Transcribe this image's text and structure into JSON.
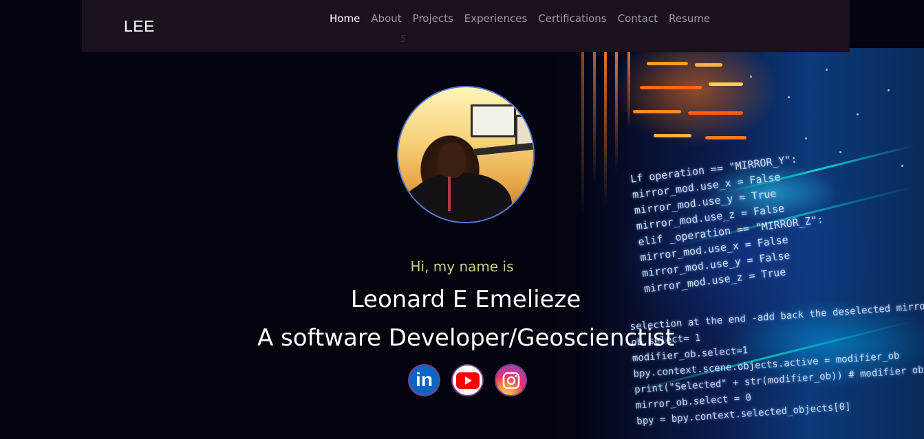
{
  "brand": "LEE",
  "nav": {
    "items": [
      "Home",
      "About",
      "Projects",
      "Experiences",
      "Certifications",
      "Contact",
      "Resume"
    ],
    "active": "Home",
    "badge": "5"
  },
  "hero": {
    "greeting": "Hi, my name is",
    "name": "Leonard E Emelieze",
    "role": "A software Developer/Geoscienctist",
    "avatar_alt": "profile photo"
  },
  "socials": [
    {
      "name": "linkedin",
      "icon": "linkedin-icon",
      "label": "in"
    },
    {
      "name": "youtube",
      "icon": "youtube-icon"
    },
    {
      "name": "instagram",
      "icon": "instagram-icon"
    }
  ],
  "background_code": {
    "lines1": [
      "Lf operation == \"MIRROR_Y\":",
      "mirror_mod.use_x = False",
      "mirror_mod.use_y = True",
      "mirror_mod.use_z = False",
      "elif _operation == \"MIRROR_Z\":",
      "mirror_mod.use_x = False",
      "mirror_mod.use_y = False",
      "mirror_mod.use_z = True"
    ],
    "lines2": [
      "selection at the end -add back the deselected mirro",
      "ob.select= 1",
      "modifier_ob.select=1",
      "bpy.context.scene.objects.active = modifier_ob",
      "print(\"Selected\" + str(modifier_ob)) # modifier ob is th",
      "mirror_ob.select = 0",
      "bpy = bpy.context.selected_objects[0]"
    ]
  },
  "colors": {
    "navbar": "#1a111c",
    "background": "#02030d",
    "greeting": "#c6cf88",
    "nav_inactive": "#9c9aa0",
    "avatar_border": "#5a78d6"
  }
}
